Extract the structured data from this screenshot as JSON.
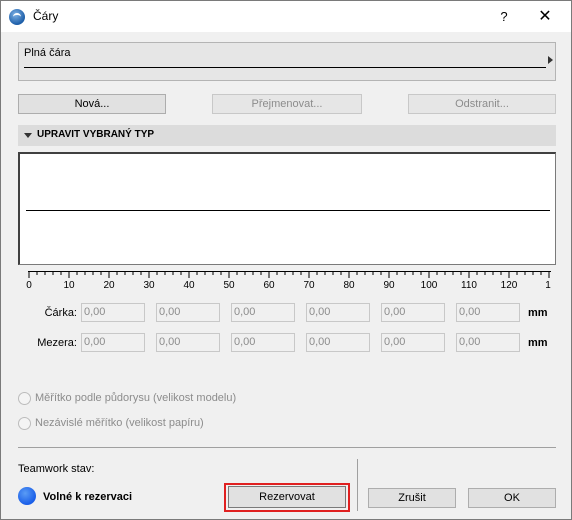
{
  "window": {
    "title": "Čáry",
    "help_label": "?",
    "close_label": "✕"
  },
  "linetype": {
    "selected": "Plná čára"
  },
  "buttons": {
    "new": "Nová...",
    "rename": "Přejmenovat...",
    "delete": "Odstranit..."
  },
  "section": {
    "title": "UPRAVIT VYBRANÝ TYP"
  },
  "ruler": {
    "labels": [
      "0",
      "10",
      "20",
      "30",
      "40",
      "50",
      "60",
      "70",
      "80",
      "90",
      "100",
      "110",
      "120",
      "1"
    ]
  },
  "dash_row": {
    "label": "Čárka:",
    "values": [
      "0,00",
      "0,00",
      "0,00",
      "0,00",
      "0,00",
      "0,00"
    ],
    "unit": "mm"
  },
  "gap_row": {
    "label": "Mezera:",
    "values": [
      "0,00",
      "0,00",
      "0,00",
      "0,00",
      "0,00",
      "0,00"
    ],
    "unit": "mm"
  },
  "scaling": {
    "option_model": "Měřítko podle půdorysu (velikost modelu)",
    "option_paper": "Nezávislé měřítko (velikost papíru)"
  },
  "teamwork": {
    "label": "Teamwork stav:",
    "status": "Volné k rezervaci",
    "status_color": "#1a5ee8",
    "reserve": "Rezervovat",
    "highlight_color": "#e02020"
  },
  "dialog": {
    "cancel": "Zrušit",
    "ok": "OK"
  }
}
